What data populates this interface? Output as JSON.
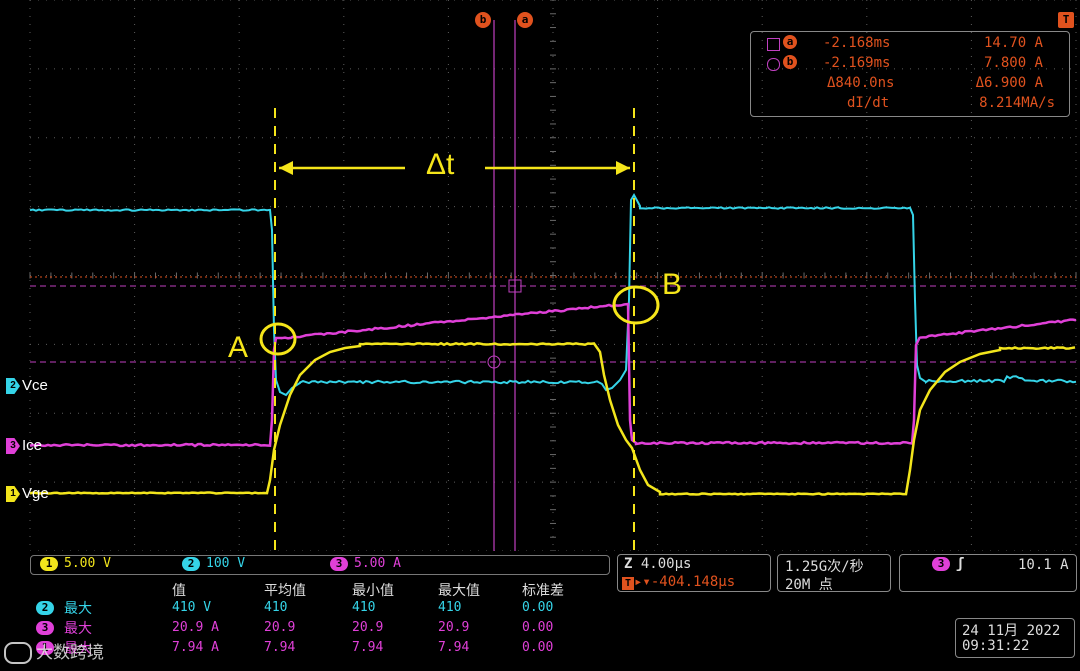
{
  "colors": {
    "ch1": "#f2e51c",
    "ch2": "#35d4e8",
    "ch3": "#e040d8",
    "cursor": "#e0521e",
    "grid": "#6a6a6a",
    "annotation": "#f5e51a"
  },
  "cursor_readout": {
    "a_symbol": "a",
    "b_symbol": "b",
    "a_time": "-2.168ms",
    "a_value": "14.70 A",
    "b_time": "-2.169ms",
    "b_value": "7.800 A",
    "delta_time": "Δ840.0ns",
    "delta_value": "Δ6.900 A",
    "slope_label": "dI/dt",
    "slope_value": "8.214MA/s"
  },
  "top_markers": {
    "b": "b",
    "a": "a",
    "trigger": "T"
  },
  "channel_labels": {
    "ch2": {
      "num": "2",
      "name": "Vce"
    },
    "ch3": {
      "num": "3",
      "name": "Ice"
    },
    "ch1": {
      "num": "1",
      "name": "Vge"
    }
  },
  "annotations": {
    "delta_t": "Δt",
    "point_a": "A",
    "point_b": "B"
  },
  "scales": {
    "ch1": {
      "num": "1",
      "value": "5.00 V"
    },
    "ch2": {
      "num": "2",
      "value": "100 V"
    },
    "ch3": {
      "num": "3",
      "value": "5.00 A"
    }
  },
  "horizontal": {
    "timebase": "4.00µs",
    "position": "-404.148µs",
    "sample_rate": "1.25G次/秒",
    "record_length": "20M 点"
  },
  "trigger": {
    "channel": "3",
    "slope_icon": "rising-edge-icon",
    "level": "10.1 A"
  },
  "measurements": {
    "headers": [
      "值",
      "平均值",
      "最小值",
      "最大值",
      "标准差"
    ],
    "rows": [
      {
        "ch": "2",
        "label": "最大",
        "value": "410 V",
        "mean": "410",
        "min": "410",
        "max": "410",
        "std": "0.00"
      },
      {
        "ch": "3",
        "label": "最大",
        "value": "20.9 A",
        "mean": "20.9",
        "min": "20.9",
        "max": "20.9",
        "std": "0.00"
      },
      {
        "ch": "1",
        "label": "最大",
        "value": "7.94 A",
        "mean": "7.94",
        "min": "7.94",
        "max": "7.94",
        "std": "0.00"
      }
    ]
  },
  "datetime": {
    "date": "24 11月 2022",
    "time": "09:31:22"
  },
  "watermark": "大数跨境"
}
